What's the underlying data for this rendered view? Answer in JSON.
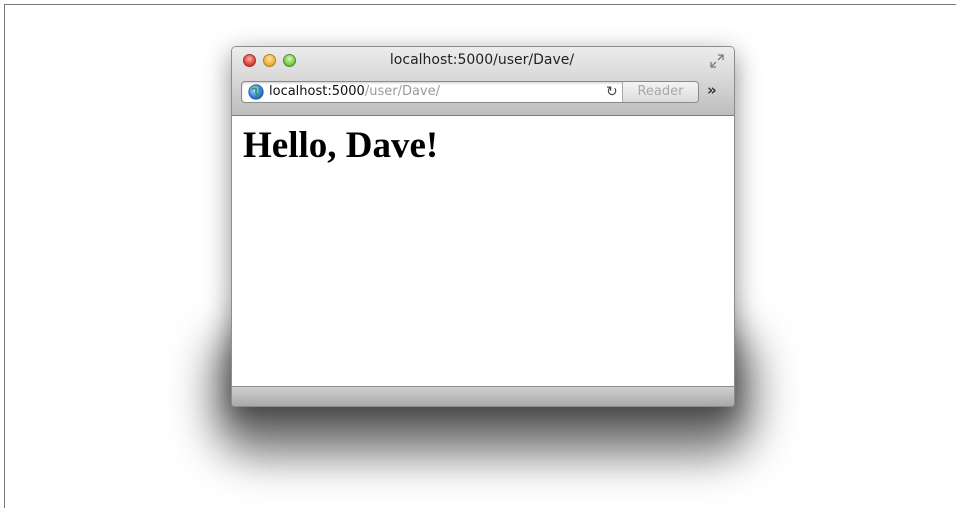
{
  "window": {
    "title": "localhost:5000/user/Dave/",
    "buttons": [
      "close",
      "minimize",
      "zoom"
    ]
  },
  "toolbar": {
    "url_host": "localhost:5000",
    "url_path": "/user/Dave/",
    "reload_icon": "↻",
    "reader_label": "Reader",
    "overflow_icon": "»"
  },
  "page": {
    "heading": "Hello, Dave!"
  },
  "icons": {
    "site": "globe-icon",
    "reload": "reload-icon",
    "fullscreen": "fullscreen-icon",
    "overflow": "chevron-double-right-icon"
  },
  "colors": {
    "close": "#e0443c",
    "minimize": "#f1b43c",
    "zoom": "#7ccc4d",
    "url_path": "#9a9a9a"
  }
}
